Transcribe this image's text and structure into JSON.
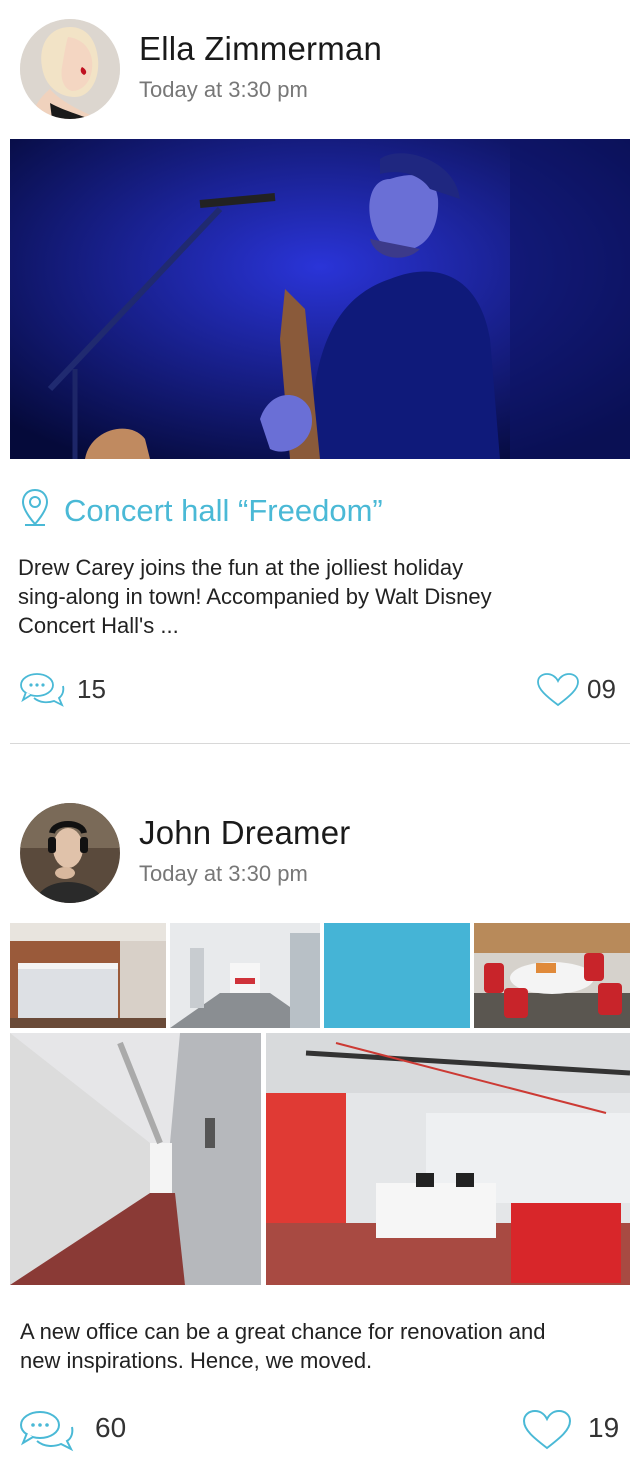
{
  "posts": [
    {
      "author": "Ella Zimmerman",
      "time": "Today at 3:30 pm",
      "location": "Concert hall “Freedom”",
      "text_lines": [
        "Drew Carey joins the fun at the jolliest holiday",
        "sing-along in town! Accompanied by Walt Disney",
        "Concert Hall's ..."
      ],
      "comments": "15",
      "likes": "09",
      "icons": {
        "location": "location-pin-icon",
        "comments": "speech-bubbles-icon",
        "likes": "heart-icon"
      }
    },
    {
      "author": "John Dreamer",
      "time": "Today at 3:30 pm",
      "text_lines": [
        "A new office can be a great chance for renovation and",
        "new inspirations. Hence, we moved."
      ],
      "comments": "60",
      "likes": "19",
      "icons": {
        "comments": "speech-bubbles-icon",
        "likes": "heart-icon"
      }
    }
  ],
  "colors": {
    "accent": "#4ab9d6",
    "tile": "#45b4d6"
  }
}
